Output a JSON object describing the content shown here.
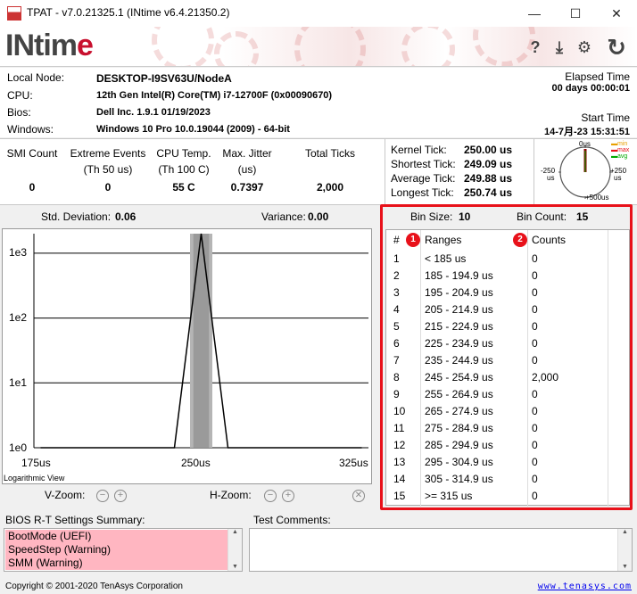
{
  "window": {
    "title": "TPAT - v7.0.21325.1 (INtime v6.4.21350.2)",
    "minimize": "—",
    "maximize": "☐",
    "close": "✕"
  },
  "banner": {
    "logo_main": "INtim",
    "logo_accent": "e",
    "help": "?",
    "download": "⤓",
    "settings": "⚙",
    "refresh": "↻"
  },
  "info": {
    "local_node_label": "Local Node:",
    "local_node": "DESKTOP-I9SV63U/NodeA",
    "cpu_label": "CPU:",
    "cpu": "12th Gen Intel(R) Core(TM) i7-12700F (0x00090670)",
    "bios_label": "Bios:",
    "bios": "Dell Inc. 1.9.1 01/19/2023",
    "windows_label": "Windows:",
    "windows": "Windows 10 Pro 10.0.19044 (2009) - 64-bit",
    "elapsed_label": "Elapsed Time",
    "elapsed": "00 days 00:00:01",
    "start_label": "Start Time",
    "start": "14-7月-23 15:31:51"
  },
  "stats": {
    "smi_h": "SMI Count",
    "smi_v": "0",
    "ext_h1": "Extreme Events",
    "ext_h2": "(Th 50 us)",
    "ext_v": "0",
    "temp_h1": "CPU Temp.",
    "temp_h2": "(Th 100 C)",
    "temp_v": "55 C",
    "jit_h1": "Max. Jitter",
    "jit_h2": "(us)",
    "jit_v": "0.7397",
    "ticks_h": "Total Ticks",
    "ticks_v": "2,000"
  },
  "ticks": {
    "kernel_l": "Kernel Tick:",
    "kernel_v": "250.00 us",
    "short_l": "Shortest Tick:",
    "short_v": "249.09 us",
    "avg_l": "Average Tick:",
    "avg_v": "249.88 us",
    "long_l": "Longest Tick:",
    "long_v": "250.74 us"
  },
  "gauge": {
    "top": "0us",
    "left": "-250",
    "left_unit": "us",
    "right": "+250",
    "right_unit": "us",
    "bottom": "+500us",
    "legend_min": "min",
    "legend_max": "max",
    "legend_avg": "avg"
  },
  "histogram": {
    "std_label": "Std. Deviation:",
    "std_value": "0.06",
    "var_label": "Variance:",
    "var_value": "0.00",
    "view_label": "Logarithmic View",
    "vzoom_label": "V-Zoom:",
    "hzoom_label": "H-Zoom:"
  },
  "chart_data": {
    "type": "line",
    "x": [
      "175us",
      "250us",
      "325us"
    ],
    "ytick_labels": [
      "1e3",
      "1e2",
      "1e1",
      "1e0"
    ],
    "yscale": "log",
    "ylim": [
      1,
      2000
    ],
    "peak_x_us": 250,
    "peak_count": 2000
  },
  "bins": {
    "size_label": "Bin Size:",
    "size_value": "10",
    "count_label": "Bin Count:",
    "count_value": "15",
    "col_num": "#",
    "col_ranges": "Ranges",
    "col_counts": "Counts",
    "badge1": "1",
    "badge2": "2",
    "rows": [
      {
        "n": "1",
        "range": "< 185 us",
        "count": "0"
      },
      {
        "n": "2",
        "range": "185 - 194.9 us",
        "count": "0"
      },
      {
        "n": "3",
        "range": "195 - 204.9 us",
        "count": "0"
      },
      {
        "n": "4",
        "range": "205 - 214.9 us",
        "count": "0"
      },
      {
        "n": "5",
        "range": "215 - 224.9 us",
        "count": "0"
      },
      {
        "n": "6",
        "range": "225 - 234.9 us",
        "count": "0"
      },
      {
        "n": "7",
        "range": "235 - 244.9 us",
        "count": "0"
      },
      {
        "n": "8",
        "range": "245 - 254.9 us",
        "count": "2,000"
      },
      {
        "n": "9",
        "range": "255 - 264.9 us",
        "count": "0"
      },
      {
        "n": "10",
        "range": "265 - 274.9 us",
        "count": "0"
      },
      {
        "n": "11",
        "range": "275 - 284.9 us",
        "count": "0"
      },
      {
        "n": "12",
        "range": "285 - 294.9 us",
        "count": "0"
      },
      {
        "n": "13",
        "range": "295 - 304.9 us",
        "count": "0"
      },
      {
        "n": "14",
        "range": "305 - 314.9 us",
        "count": "0"
      },
      {
        "n": "15",
        "range": ">= 315 us",
        "count": "0"
      }
    ]
  },
  "bios_summary": {
    "label": "BIOS R-T Settings Summary:",
    "items": [
      "BootMode (UEFI)",
      "SpeedStep (Warning)",
      "SMM (Warning)"
    ]
  },
  "comments": {
    "label": "Test Comments:"
  },
  "footer": {
    "copyright": "Copyright © 2001-2020 TenAsys Corporation",
    "link": "www.tenasys.com"
  },
  "colors": {
    "highlight_red": "#e8111a",
    "warning_pink": "#ffb6c1",
    "gauge_needle": "#8b0000",
    "brand_red": "#c8102e"
  }
}
